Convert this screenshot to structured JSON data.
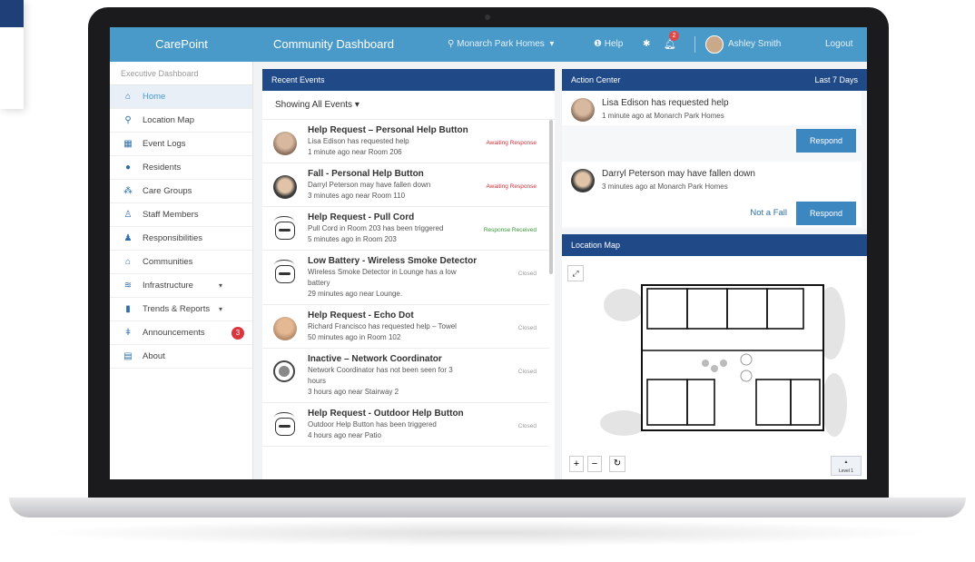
{
  "app": {
    "brand": "CarePoint",
    "title": "Community Dashboard"
  },
  "nav": {
    "location": "Monarch Park Homes",
    "help": "Help",
    "notifications_count": "2",
    "user": "Ashley Smith",
    "logout": "Logout"
  },
  "sidebar": {
    "header": "Executive Dashboard",
    "items": [
      {
        "label": "Home",
        "icon": "home-icon"
      },
      {
        "label": "Location Map",
        "icon": "map-pin-icon"
      },
      {
        "label": "Event Logs",
        "icon": "log-icon"
      },
      {
        "label": "Residents",
        "icon": "person-icon"
      },
      {
        "label": "Care Groups",
        "icon": "group-icon"
      },
      {
        "label": "Staff Members",
        "icon": "staff-icon"
      },
      {
        "label": "Responsibilities",
        "icon": "responsibilities-icon"
      },
      {
        "label": "Communities",
        "icon": "community-icon"
      },
      {
        "label": "Infrastructure",
        "icon": "wifi-icon"
      },
      {
        "label": "Trends & Reports",
        "icon": "bar-chart-icon"
      },
      {
        "label": "Announcements",
        "icon": "pin-icon",
        "badge": "3"
      },
      {
        "label": "About",
        "icon": "info-icon"
      }
    ]
  },
  "events": {
    "header": "Recent Events",
    "filter": "Showing All Events",
    "items": [
      {
        "title": "Help Request – Personal Help Button",
        "desc": "Lisa Edison has requested help",
        "time": "1 minute ago near Room 206",
        "status": "Awaiting Response"
      },
      {
        "title": "Fall - Personal Help Button",
        "desc": "Darryl Peterson may have fallen down",
        "time": "3 minutes ago near Room 110",
        "status": "Awaiting Response"
      },
      {
        "title": "Help Request - Pull Cord",
        "desc": "Pull Cord in Room 203 has been triggered",
        "time": "5 minutes ago in Room 203",
        "status": "Response Received"
      },
      {
        "title": "Low Battery - Wireless Smoke Detector",
        "desc": "Wireless Smoke Detector in Lounge has a low battery",
        "time": "29 minutes ago near Lounge.",
        "status": "Closed"
      },
      {
        "title": "Help Request - Echo Dot",
        "desc": "Richard Francisco has requested help – Towel",
        "time": "50 minutes ago in Room 102",
        "status": "Closed"
      },
      {
        "title": "Inactive – Network Coordinator",
        "desc": "Network Coordinator has not been seen for 3 hours",
        "time": "3 hours ago near Stairway 2",
        "status": "Closed"
      },
      {
        "title": "Help Request - Outdoor Help Button",
        "desc": "Outdoor Help Button has been triggered",
        "time": "4 hours ago near Patio",
        "status": "Closed"
      }
    ]
  },
  "action_center": {
    "header": "Action Center",
    "range": "Last 7 Days",
    "cards": [
      {
        "message": "Lisa Edison has requested help",
        "time": "1 minute ago at Monarch Park Homes",
        "respond": "Respond"
      },
      {
        "message": "Darryl Peterson may have fallen down",
        "time": "3 minutes ago at Monarch Park Homes",
        "no_fall": "Not a Fall",
        "respond": "Respond"
      }
    ]
  },
  "location_map": {
    "header": "Location Map",
    "level": "Level 1"
  },
  "colors": {
    "nav": "#4a9ac9",
    "panel_header": "#1f4a87",
    "respond": "#3d87c0",
    "alert": "#d0313a",
    "ok": "#3a9a3a"
  }
}
